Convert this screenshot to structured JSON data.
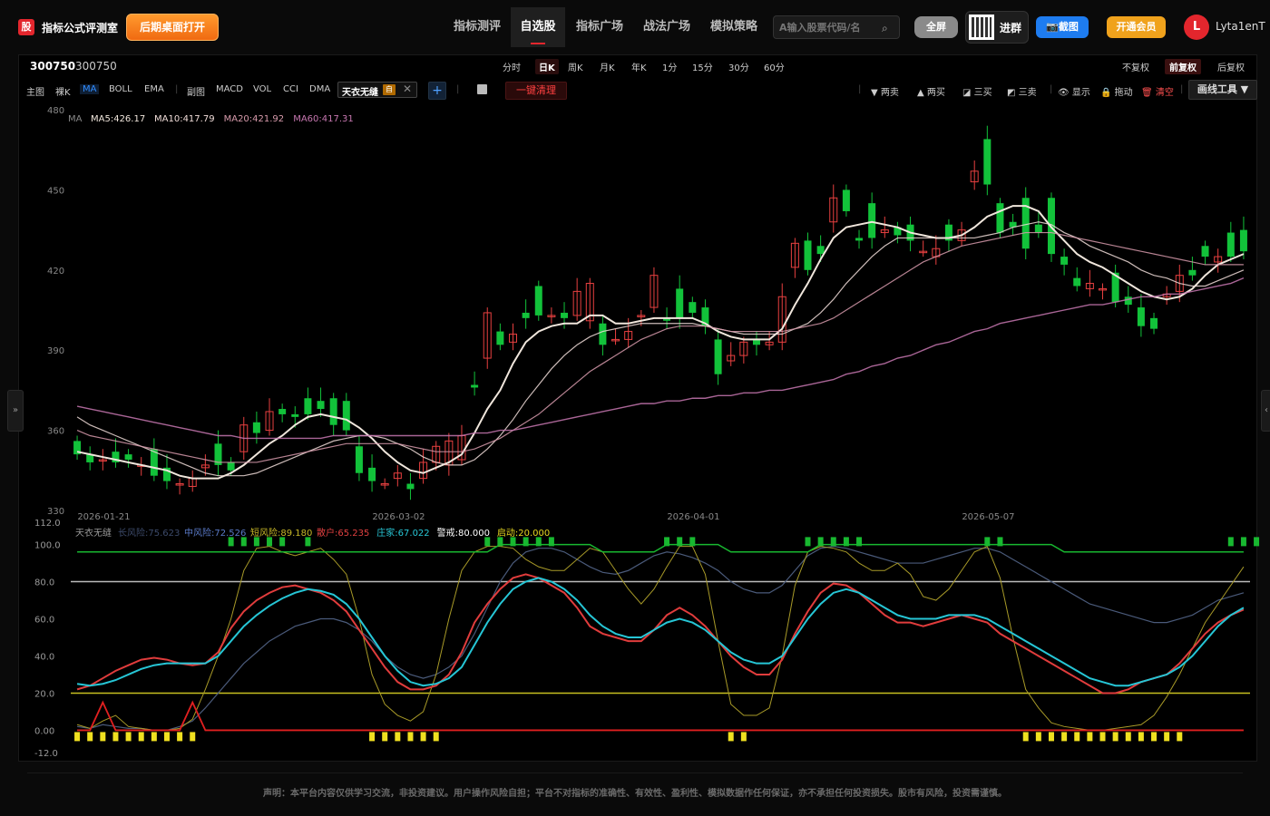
{
  "app": {
    "logo_char": "股",
    "title": "指标公式评测室",
    "open_desktop": "后期桌面打开"
  },
  "nav": {
    "items": [
      "指标测评",
      "自选股",
      "指标广场",
      "战法广场",
      "模拟策略"
    ],
    "active_index": 1
  },
  "search": {
    "placeholder": "A输入股票代码/名"
  },
  "header_buttons": {
    "fullscreen": "全屏",
    "join_group": "进群",
    "screenshot": "📷截图",
    "vip": "开通会员"
  },
  "user": {
    "avatar_letter": "L",
    "name": "Lyta1enT"
  },
  "stock": {
    "code": "300750",
    "name": "300750"
  },
  "periods": [
    "分时",
    "日K",
    "周K",
    "月K",
    "年K",
    "1分",
    "15分",
    "30分",
    "60分"
  ],
  "active_period": "日K",
  "adjust": [
    "不复权",
    "前复权",
    "后复权"
  ],
  "active_adjust": "前复权",
  "indicators_main": [
    "主图",
    "裸K",
    "MA",
    "BOLL",
    "EMA"
  ],
  "active_indicator": "MA",
  "indicators_sub": [
    "副图",
    "MACD",
    "VOL",
    "CCI",
    "DMA"
  ],
  "custom_indicator": {
    "label": "天衣无缝",
    "tag": "自"
  },
  "clear_label": "一键清理",
  "tools": [
    "▼ 两卖",
    "▲ 两买",
    "◪ 三买",
    "◩ 三卖",
    "👁 显示",
    "🔒 拖动",
    "🗑 清空"
  ],
  "draw_tool_label": "画线工具 ▼",
  "side": {
    "left": "»",
    "right": "‹"
  },
  "ma_legend": {
    "prefix": "MA",
    "items": [
      "MA5:426.17",
      "MA10:417.79",
      "MA20:421.92",
      "MA60:417.31"
    ],
    "colors": [
      "#f0e6dc",
      "#f0dcd8",
      "#d79aab",
      "#c777b0"
    ]
  },
  "sub_legend": {
    "name": "天衣无缝",
    "items": [
      "长风险:75.623",
      "中风险:72.526",
      "短风险:89.180",
      "散户:65.235",
      "庄家:67.022",
      "警戒:80.000",
      "启动:20.000"
    ],
    "colors": [
      "#3c4a6a",
      "#5a7ac8",
      "#c8b828",
      "#e04040",
      "#28c8d8",
      "#ffffff",
      "#e8d820"
    ]
  },
  "disclaimer": "声明：本平台内容仅供学习交流，非投资建议。用户操作风险自担；平台不对指标的准确性、有效性、盈利性、模拟数据作任何保证，亦不承担任何投资损失。股市有风险，投资需谨慎。",
  "chart_data": {
    "type": "candlestick",
    "y_axis_ticks": [
      "480",
      "450",
      "420",
      "390",
      "360",
      "330"
    ],
    "ylim": [
      330,
      480
    ],
    "x_labels": [
      "2026-01-21",
      "2026-03-02",
      "2026-04-01",
      "2026-05-07"
    ],
    "x_label_positions_index": [
      2,
      25,
      48,
      71
    ],
    "candles": [
      {
        "o": 356,
        "c": 351
      },
      {
        "o": 351,
        "c": 348
      },
      {
        "o": 349,
        "c": 349
      },
      {
        "o": 352,
        "c": 348
      },
      {
        "o": 351,
        "c": 349
      },
      {
        "o": 347,
        "c": 347
      },
      {
        "o": 353,
        "c": 343
      },
      {
        "o": 346,
        "c": 341
      },
      {
        "o": 340,
        "c": 340
      },
      {
        "o": 339,
        "c": 342
      },
      {
        "o": 346,
        "c": 347
      },
      {
        "o": 355,
        "c": 347
      },
      {
        "o": 348,
        "c": 345
      },
      {
        "o": 352,
        "c": 362
      },
      {
        "o": 363,
        "c": 359
      },
      {
        "o": 360,
        "c": 367
      },
      {
        "o": 368,
        "c": 366
      },
      {
        "o": 366,
        "c": 365
      },
      {
        "o": 372,
        "c": 366
      },
      {
        "o": 371,
        "c": 368
      },
      {
        "o": 372,
        "c": 362
      },
      {
        "o": 371,
        "c": 360
      },
      {
        "o": 354,
        "c": 344
      },
      {
        "o": 346,
        "c": 341
      },
      {
        "o": 340,
        "c": 340
      },
      {
        "o": 342,
        "c": 344
      },
      {
        "o": 340,
        "c": 338
      },
      {
        "o": 342,
        "c": 348
      },
      {
        "o": 348,
        "c": 354
      },
      {
        "o": 347,
        "c": 356
      },
      {
        "o": 349,
        "c": 358
      },
      {
        "o": 377,
        "c": 376
      },
      {
        "o": 387,
        "c": 404
      },
      {
        "o": 397,
        "c": 392
      },
      {
        "o": 393,
        "c": 396
      },
      {
        "o": 404,
        "c": 402
      },
      {
        "o": 414,
        "c": 403
      },
      {
        "o": 403,
        "c": 403
      },
      {
        "o": 404,
        "c": 402
      },
      {
        "o": 403,
        "c": 412
      },
      {
        "o": 401,
        "c": 415
      },
      {
        "o": 400,
        "c": 392
      },
      {
        "o": 394,
        "c": 394
      },
      {
        "o": 394,
        "c": 397
      },
      {
        "o": 403,
        "c": 403
      },
      {
        "o": 406,
        "c": 418
      },
      {
        "o": 402,
        "c": 401
      },
      {
        "o": 413,
        "c": 402
      },
      {
        "o": 408,
        "c": 404
      },
      {
        "o": 406,
        "c": 399
      },
      {
        "o": 394,
        "c": 381
      },
      {
        "o": 386,
        "c": 388
      },
      {
        "o": 388,
        "c": 393
      },
      {
        "o": 394,
        "c": 392
      },
      {
        "o": 392,
        "c": 393
      },
      {
        "o": 393,
        "c": 410
      },
      {
        "o": 421,
        "c": 430
      },
      {
        "o": 431,
        "c": 420
      },
      {
        "o": 429,
        "c": 426
      },
      {
        "o": 438,
        "c": 447
      },
      {
        "o": 450,
        "c": 442
      },
      {
        "o": 432,
        "c": 431
      },
      {
        "o": 445,
        "c": 432
      },
      {
        "o": 434,
        "c": 435
      },
      {
        "o": 436,
        "c": 433
      },
      {
        "o": 437,
        "c": 431
      },
      {
        "o": 427,
        "c": 427
      },
      {
        "o": 425,
        "c": 428
      },
      {
        "o": 437,
        "c": 431
      },
      {
        "o": 431,
        "c": 435
      },
      {
        "o": 453,
        "c": 457
      },
      {
        "o": 469,
        "c": 452
      },
      {
        "o": 445,
        "c": 434
      },
      {
        "o": 438,
        "c": 436
      },
      {
        "o": 447,
        "c": 428
      },
      {
        "o": 437,
        "c": 434
      },
      {
        "o": 447,
        "c": 426
      },
      {
        "o": 425,
        "c": 422
      },
      {
        "o": 417,
        "c": 414
      },
      {
        "o": 413,
        "c": 415
      },
      {
        "o": 413,
        "c": 413
      },
      {
        "o": 419,
        "c": 408
      },
      {
        "o": 410,
        "c": 407
      },
      {
        "o": 406,
        "c": 399
      },
      {
        "o": 402,
        "c": 398
      },
      {
        "o": 410,
        "c": 411
      },
      {
        "o": 412,
        "c": 418
      },
      {
        "o": 420,
        "c": 418
      },
      {
        "o": 429,
        "c": 425
      },
      {
        "o": 423,
        "c": 425
      },
      {
        "o": 434,
        "c": 425
      },
      {
        "o": 435,
        "c": 427
      }
    ],
    "ma": [
      [
        352,
        351,
        350,
        349,
        348,
        347,
        346,
        345,
        343,
        342,
        342,
        342,
        344,
        347,
        351,
        355,
        358,
        362,
        365,
        366,
        365,
        364,
        361,
        357,
        352,
        348,
        345,
        344,
        346,
        348,
        351,
        359,
        368,
        375,
        385,
        393,
        397,
        399,
        400,
        400,
        403,
        403,
        400,
        400,
        401,
        402,
        402,
        402,
        402,
        400,
        397,
        395,
        394,
        394,
        394,
        398,
        407,
        415,
        424,
        432,
        436,
        437,
        438,
        437,
        436,
        434,
        433,
        432,
        432,
        433,
        436,
        440,
        442,
        444,
        444,
        442,
        436,
        431,
        426,
        423,
        421,
        418,
        415,
        412,
        410,
        409,
        410,
        413,
        418,
        422,
        424,
        426
      ],
      [
        365,
        362,
        360,
        358,
        356,
        354,
        352,
        350,
        348,
        346,
        344,
        343,
        343,
        343,
        344,
        346,
        348,
        350,
        352,
        354,
        356,
        357,
        358,
        358,
        357,
        355,
        353,
        350,
        348,
        347,
        347,
        349,
        353,
        358,
        364,
        371,
        377,
        383,
        388,
        392,
        395,
        397,
        398,
        399,
        400,
        400,
        400,
        400,
        400,
        399,
        398,
        397,
        396,
        396,
        396,
        396,
        398,
        400,
        404,
        409,
        415,
        420,
        425,
        429,
        432,
        432,
        432,
        432,
        432,
        432,
        432,
        433,
        434,
        436,
        437,
        438,
        437,
        434,
        432,
        429,
        427,
        425,
        423,
        420,
        418,
        417,
        415,
        414,
        414,
        416,
        418,
        420
      ],
      [
        360,
        358,
        357,
        356,
        355,
        354,
        353,
        352,
        351,
        350,
        349,
        348,
        348,
        348,
        348,
        349,
        350,
        351,
        352,
        353,
        354,
        355,
        355,
        355,
        355,
        355,
        354,
        353,
        352,
        352,
        352,
        353,
        355,
        357,
        360,
        363,
        366,
        370,
        374,
        378,
        382,
        385,
        388,
        391,
        394,
        396,
        398,
        399,
        399,
        399,
        398,
        397,
        397,
        397,
        397,
        397,
        398,
        399,
        400,
        402,
        405,
        408,
        411,
        414,
        417,
        420,
        423,
        425,
        427,
        429,
        430,
        431,
        432,
        433,
        434,
        434,
        434,
        433,
        432,
        431,
        430,
        429,
        428,
        427,
        426,
        425,
        424,
        423,
        422,
        422,
        422,
        422
      ],
      [
        369,
        368,
        367,
        366,
        365,
        364,
        363,
        362,
        361,
        360,
        359,
        358,
        358,
        357,
        357,
        357,
        357,
        357,
        357,
        357,
        358,
        358,
        358,
        358,
        358,
        358,
        358,
        358,
        358,
        358,
        358,
        359,
        359,
        360,
        360,
        361,
        362,
        363,
        364,
        365,
        366,
        367,
        368,
        369,
        370,
        370,
        371,
        371,
        372,
        372,
        373,
        373,
        374,
        374,
        375,
        375,
        376,
        377,
        378,
        379,
        381,
        382,
        384,
        385,
        387,
        388,
        390,
        392,
        393,
        395,
        397,
        398,
        400,
        401,
        402,
        403,
        404,
        405,
        406,
        407,
        407,
        408,
        409,
        410,
        410,
        411,
        411,
        412,
        413,
        414,
        415,
        417
      ]
    ],
    "sub_ylim": [
      -12,
      112
    ],
    "sub_y_ticks": [
      "112.0",
      "100.0",
      "80.0",
      "60.0",
      "40.0",
      "20.0",
      "0.00",
      "-12.0"
    ],
    "warn_level": 80,
    "start_level": 20,
    "series": {
      "long_risk": [
        25,
        24,
        26,
        28,
        30,
        32,
        34,
        35,
        36,
        35,
        35,
        37,
        42,
        48,
        55,
        62,
        66,
        70,
        73,
        75,
        74,
        72,
        68,
        62,
        55,
        50,
        46,
        44,
        44,
        46,
        50,
        58,
        68,
        76,
        81,
        84,
        84,
        82,
        80,
        78,
        76,
        74,
        72,
        72,
        73,
        75,
        76,
        77,
        78,
        78,
        76,
        72,
        68,
        64,
        62,
        62,
        66,
        72,
        78,
        82,
        84,
        84,
        82,
        80,
        78,
        78,
        78,
        78,
        80,
        82,
        84,
        85,
        84,
        82,
        80,
        78,
        76,
        74,
        72,
        70,
        68,
        66,
        64,
        62,
        60,
        58,
        60,
        62,
        66,
        70,
        72,
        74
      ],
      "mid_risk": [
        2,
        1,
        3,
        2,
        1,
        1,
        0,
        0,
        2,
        5,
        12,
        20,
        28,
        36,
        42,
        48,
        52,
        56,
        58,
        60,
        60,
        58,
        54,
        48,
        40,
        34,
        30,
        28,
        30,
        34,
        40,
        52,
        66,
        80,
        90,
        96,
        98,
        98,
        96,
        92,
        88,
        85,
        84,
        86,
        90,
        94,
        96,
        95,
        93,
        90,
        86,
        80,
        76,
        74,
        74,
        78,
        86,
        94,
        98,
        99,
        98,
        96,
        94,
        92,
        90,
        90,
        90,
        92,
        94,
        96,
        98,
        98,
        96,
        92,
        88,
        84,
        80,
        76,
        72,
        68,
        66,
        64,
        62,
        60,
        58,
        58,
        60,
        62,
        66,
        70,
        72,
        74
      ],
      "short_risk": [
        3,
        1,
        5,
        8,
        2,
        1,
        0,
        0,
        1,
        6,
        22,
        40,
        60,
        86,
        98,
        99,
        96,
        94,
        96,
        98,
        92,
        84,
        60,
        30,
        14,
        8,
        5,
        10,
        30,
        60,
        86,
        96,
        99,
        99,
        98,
        92,
        88,
        86,
        86,
        92,
        98,
        96,
        86,
        76,
        68,
        76,
        88,
        99,
        99,
        84,
        48,
        14,
        8,
        8,
        12,
        40,
        78,
        96,
        99,
        98,
        96,
        90,
        86,
        86,
        90,
        84,
        72,
        70,
        76,
        86,
        96,
        99,
        82,
        50,
        22,
        12,
        4,
        2,
        1,
        0,
        0,
        1,
        2,
        3,
        8,
        18,
        30,
        44,
        58,
        68,
        78,
        88
      ],
      "retail": [
        22,
        24,
        28,
        32,
        35,
        38,
        39,
        38,
        36,
        35,
        36,
        42,
        55,
        64,
        70,
        74,
        77,
        78,
        76,
        74,
        70,
        64,
        54,
        44,
        34,
        26,
        22,
        22,
        24,
        30,
        42,
        58,
        68,
        76,
        82,
        84,
        82,
        78,
        74,
        66,
        56,
        52,
        50,
        48,
        48,
        54,
        62,
        66,
        62,
        56,
        48,
        40,
        34,
        30,
        30,
        38,
        52,
        64,
        74,
        79,
        78,
        74,
        68,
        62,
        58,
        58,
        56,
        58,
        60,
        62,
        60,
        58,
        52,
        48,
        44,
        40,
        36,
        32,
        28,
        24,
        20,
        20,
        22,
        26,
        28,
        30,
        36,
        44,
        52,
        58,
        62,
        65
      ],
      "dealer": [
        25,
        24,
        25,
        27,
        30,
        33,
        35,
        36,
        36,
        36,
        36,
        40,
        48,
        56,
        62,
        67,
        71,
        74,
        76,
        75,
        73,
        68,
        60,
        50,
        40,
        32,
        26,
        24,
        25,
        28,
        34,
        46,
        58,
        68,
        76,
        80,
        82,
        80,
        76,
        70,
        62,
        56,
        52,
        50,
        50,
        54,
        58,
        60,
        58,
        54,
        48,
        42,
        38,
        36,
        36,
        40,
        50,
        60,
        68,
        74,
        76,
        74,
        70,
        66,
        62,
        60,
        60,
        60,
        62,
        62,
        62,
        60,
        56,
        52,
        48,
        44,
        40,
        36,
        32,
        28,
        26,
        24,
        24,
        26,
        28,
        30,
        34,
        40,
        48,
        56,
        62,
        66
      ]
    },
    "green_markers_idx": [
      12,
      13,
      14,
      15,
      16,
      18,
      32,
      33,
      34,
      35,
      36,
      37,
      46,
      47,
      48,
      57,
      58,
      59,
      60,
      61,
      71,
      72,
      90,
      91,
      92
    ],
    "yellow_markers_idx": [
      0,
      1,
      2,
      3,
      4,
      5,
      6,
      7,
      8,
      9,
      23,
      24,
      25,
      26,
      27,
      28,
      51,
      52,
      74,
      75,
      76,
      77,
      78,
      79,
      80,
      81,
      82,
      83,
      84,
      85,
      86
    ]
  }
}
